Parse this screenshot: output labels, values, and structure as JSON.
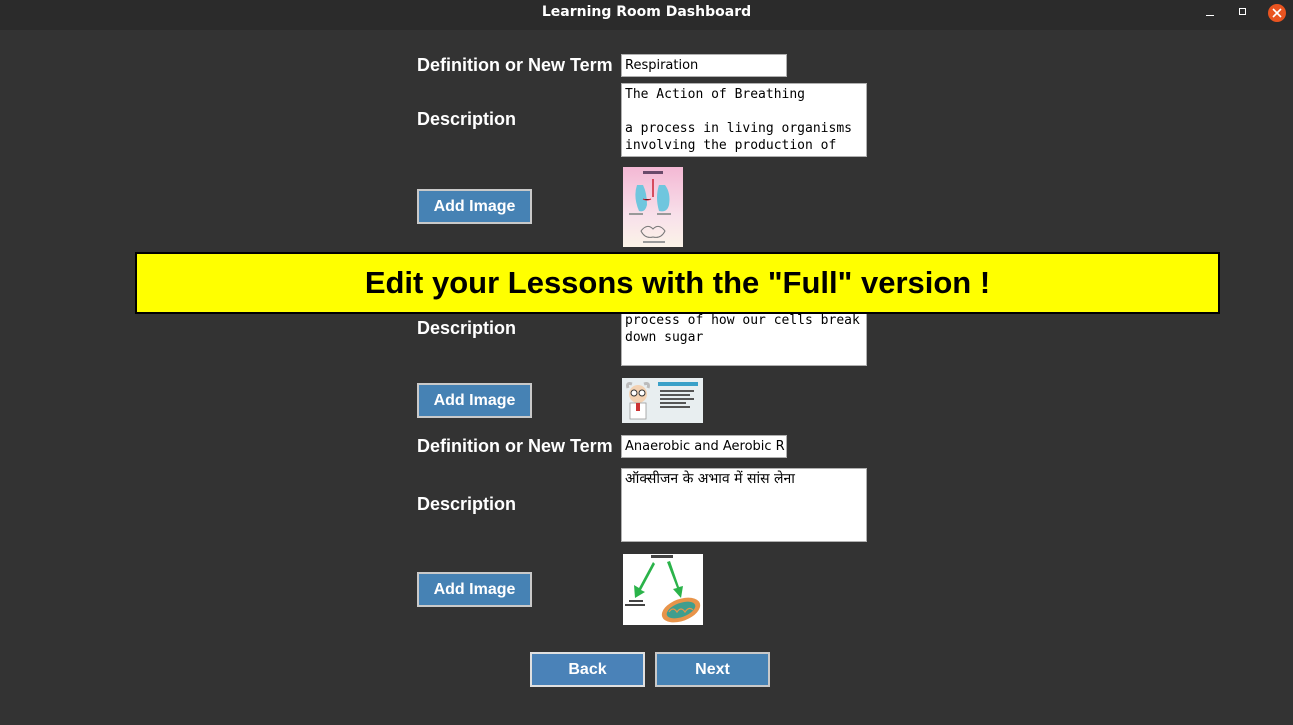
{
  "window": {
    "title": "Learning Room Dashboard"
  },
  "banner": {
    "text": "Edit your Lessons with the \"Full\" version !"
  },
  "lessons": [
    {
      "term_label": "Definition or New Term",
      "term_value": "Respiration",
      "description_label": "Description",
      "description_text": "The Action of Breathing\n\na process in living organisms involving the production of",
      "add_image_label": "Add Image",
      "image_icon": "respiration-lungs-diagram"
    },
    {
      "description_label": "Description",
      "description_text": "process of how our cells break down sugar",
      "add_image_label": "Add Image",
      "image_icon": "cellular-respiration-cartoon"
    },
    {
      "term_label": "Definition or New Term",
      "term_value": "Anaerobic and Aerobic R",
      "description_label": "Description",
      "description_text": "ऑक्सीजन के अभाव में सांस लेना",
      "add_image_label": "Add Image",
      "image_icon": "pyruvate-mitochondria-diagram"
    }
  ],
  "nav": {
    "back_label": "Back",
    "next_label": "Next"
  },
  "colors": {
    "background": "#333333",
    "button": "#4682b4",
    "banner": "#ffff00",
    "close_button": "#e95420"
  }
}
